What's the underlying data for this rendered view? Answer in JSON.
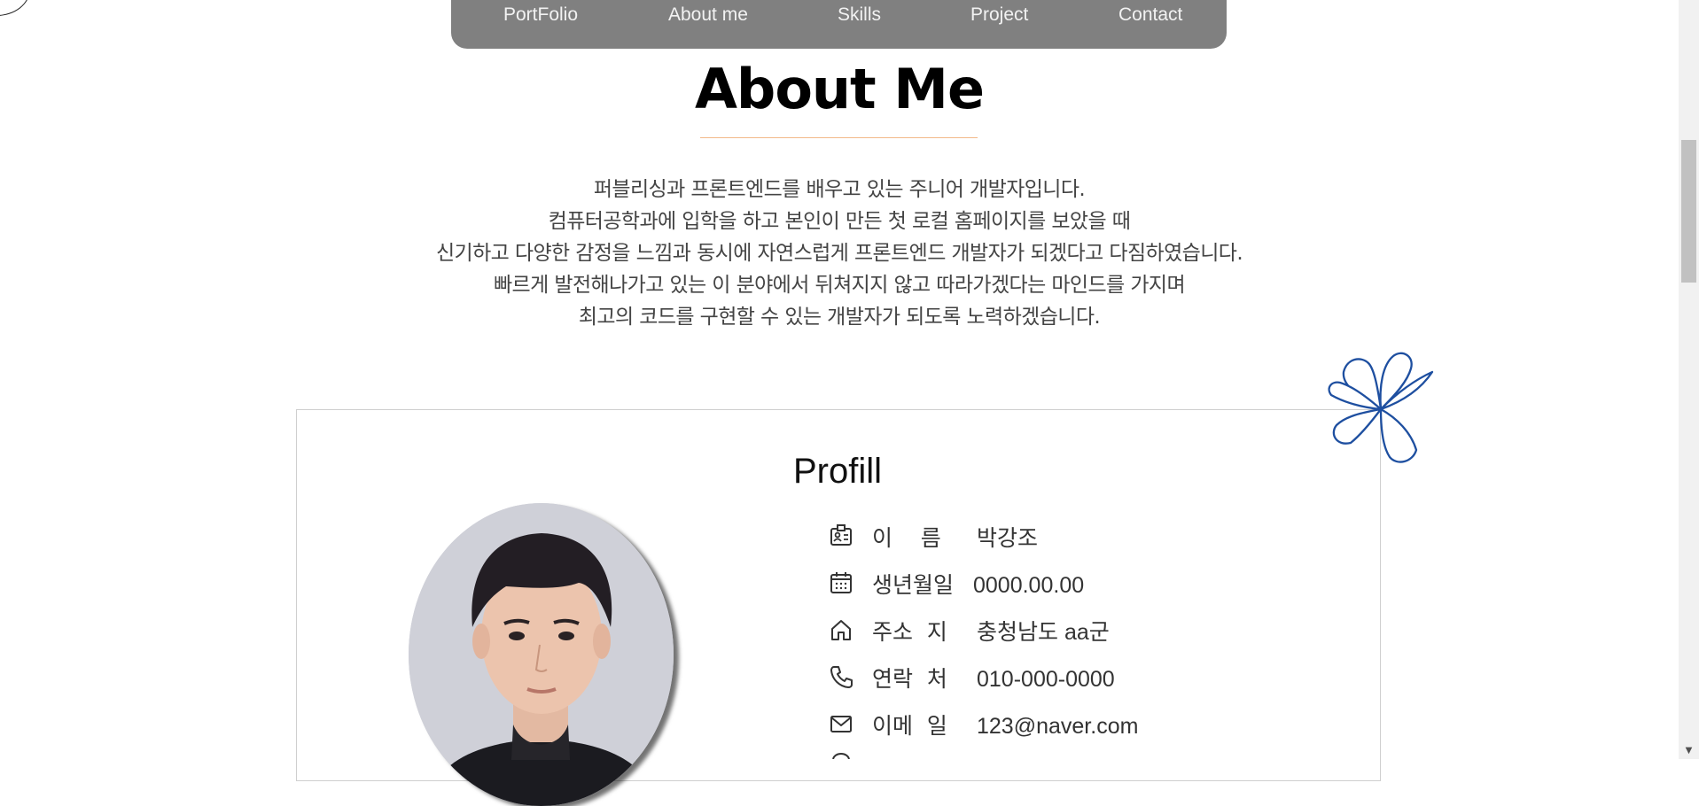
{
  "nav": {
    "items": [
      {
        "label": "PortFolio"
      },
      {
        "label": "About me"
      },
      {
        "label": "Skills"
      },
      {
        "label": "Project"
      },
      {
        "label": "Contact"
      }
    ]
  },
  "about": {
    "title": "About Me",
    "intro": [
      "퍼블리싱과 프론트엔드를 배우고 있는 주니어 개발자입니다.",
      "컴퓨터공학과에 입학을 하고 본인이 만든 첫 로컬 홈페이지를 보았을 때",
      "신기하고 다양한 감정을 느낌과 동시에 자연스럽게 프론트엔드 개발자가 되겠다고 다짐하였습니다.",
      "빠르게 발전해나가고 있는 이 분야에서 뒤쳐지지 않고 따라가겠다는 마인드를 가지며",
      "최고의 코드를 구현할 수 있는 개발자가 되도록 노력하겠습니다."
    ]
  },
  "profile": {
    "title": "Profill",
    "rows": [
      {
        "icon": "id-card-icon",
        "label": "이    름",
        "value": "박강조"
      },
      {
        "icon": "calendar-icon",
        "label": "생년월일",
        "value": "0000.00.00"
      },
      {
        "icon": "home-icon",
        "label": "주소  지",
        "value": "충청남도 aa군"
      },
      {
        "icon": "phone-icon",
        "label": "연락  처",
        "value": "010-000-0000"
      },
      {
        "icon": "mail-icon",
        "label": "이메  일",
        "value": "123@naver.com"
      }
    ]
  },
  "colors": {
    "nav_bg": "#808080",
    "accent_line": "#f2b98a",
    "flower": "#1e4fa0"
  }
}
